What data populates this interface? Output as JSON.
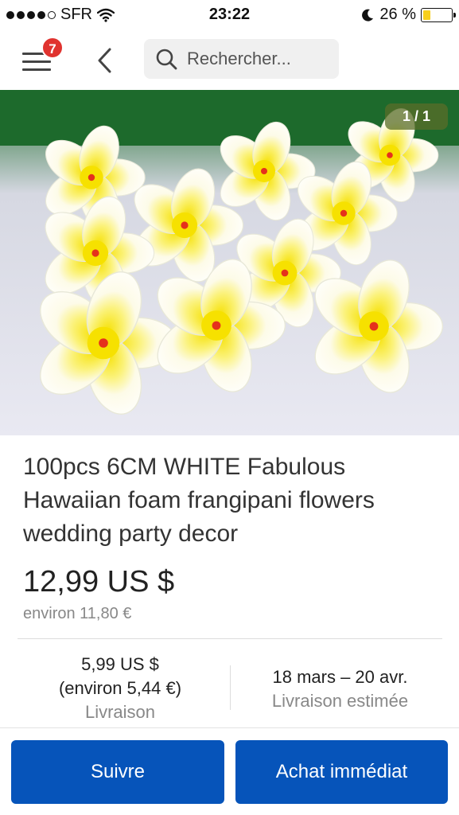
{
  "status_bar": {
    "carrier": "SFR",
    "time": "23:22",
    "battery_percent": "26 %",
    "battery_level": 0.26,
    "icons": [
      "signal-dots-icon",
      "wifi-icon",
      "moon-icon",
      "battery-icon"
    ]
  },
  "header": {
    "notification_count": "7",
    "search_placeholder": "Rechercher..."
  },
  "image": {
    "counter": "1 / 1"
  },
  "listing": {
    "title": "100pcs 6CM WHITE Fabulous Hawaiian foam frangipani flowers wedding party decor",
    "price": "12,99 US $",
    "price_converted": "environ 11,80 €"
  },
  "shipping": {
    "cost": "5,99 US $",
    "cost_converted": "(environ 5,44 €)",
    "cost_label": "Livraison",
    "delivery_dates": "18 mars – 20 avr.",
    "delivery_label": "Livraison estimée"
  },
  "actions": {
    "follow": "Suivre",
    "buy_now": "Achat immédiat"
  },
  "colors": {
    "primary_button": "#0654ba",
    "badge": "#e0332f",
    "battery": "#f7cf1c"
  }
}
